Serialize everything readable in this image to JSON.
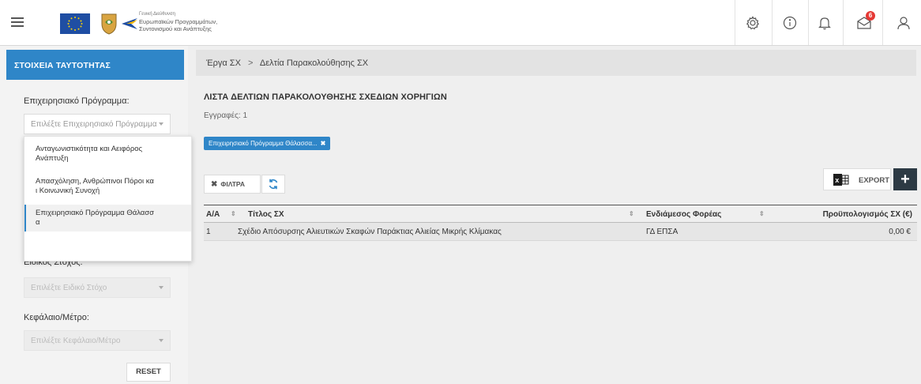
{
  "header": {
    "logo_text_line1": "Γενική Διεύθυνση",
    "logo_text_line2": "Ευρωπαϊκών Προγραμμάτων,",
    "logo_text_line3": "Συντονισμού και Ανάπτυξης",
    "notification_count": "6",
    "icons": [
      "menu-icon",
      "settings-icon",
      "info-icon",
      "bell-icon",
      "messages-icon",
      "user-icon"
    ]
  },
  "sidebar": {
    "tab_label": "ΣΤΟΙΧΕΙΑ ΤΑΥΤΟΤΗΤΑΣ",
    "program_label": "Επιχειρησιακό Πρόγραμμα:",
    "program_placeholder": "Επιλέξτε Επιχειρησιακό Πρόγραμμα",
    "program_options": [
      {
        "line1": "Ανταγωνιστικότητα και Αειφόρος",
        "line2": "Ανάπτυξη"
      },
      {
        "line1": "Απασχόληση, Ανθρώπινοι Πόροι κα",
        "line2": "ι Κοινωνική Συνοχή"
      },
      {
        "line1": "Επιχειρησιακό Πρόγραμμα Θάλασσ",
        "line2": "α"
      }
    ],
    "objective_label": "Ειδικός Στόχος:",
    "objective_placeholder": "Επιλέξτε Ειδικό Στόχο",
    "measure_label": "Κεφάλαιο/Μέτρο:",
    "measure_placeholder": "Επιλέξτε Κεφάλαιο/Μέτρο",
    "reset_label": "RESET"
  },
  "breadcrumb": {
    "item1": "Έργα ΣΧ",
    "separator": ">",
    "item2": "Δελτία Παρακολούθησης ΣΧ"
  },
  "main": {
    "title": "ΛΙΣΤΑ ΔΕΛΤΙΩΝ ΠΑΡΑΚΟΛΟΥΘΗΣΗΣ ΣΧΕΔΙΩΝ ΧΟΡΗΓΙΩΝ",
    "records": "Εγγραφές: 1",
    "filter_chip": "Επιχειρησιακό Πρόγραμμα Θάλασσα...",
    "filters_label": "ΦΙΛΤΡΑ",
    "export_label": "EXPORT",
    "add_label": "+"
  },
  "table": {
    "columns": [
      "Α/Α",
      "Τίτλος ΣΧ",
      "Ενδιάμεσος Φορέας",
      "Προϋπολογισμός ΣΧ (€)"
    ],
    "rows": [
      {
        "aa": "1",
        "title": "Σχέδιο Απόσυρσης Αλιευτικών Σκαφών Παράκτιας Αλιείας Μικρής Κλίμακας",
        "body": "ΓΔ ΕΠΣΑ",
        "budget": "0,00 €"
      }
    ]
  },
  "colors": {
    "accent": "#2f86c8",
    "dark_button": "#2d3a44",
    "badge": "#e53935"
  }
}
